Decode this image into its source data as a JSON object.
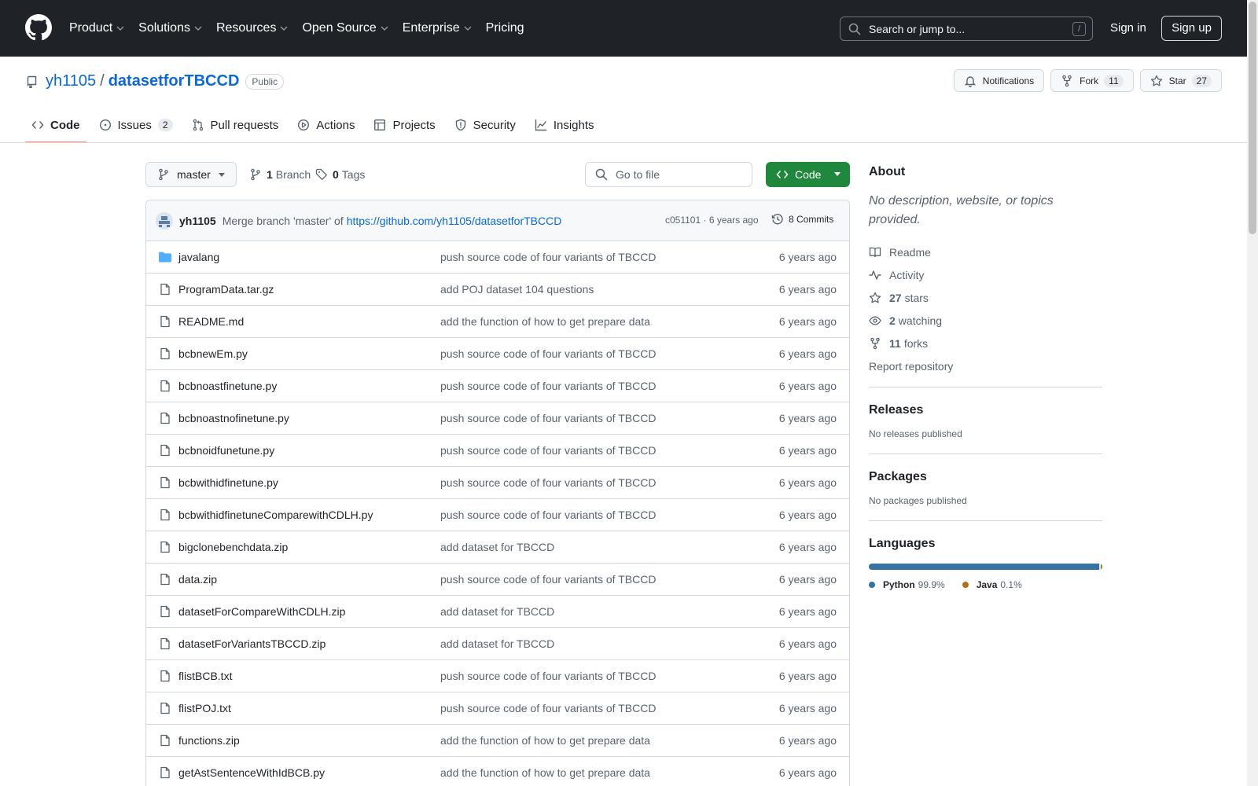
{
  "header": {
    "nav": [
      {
        "label": "Product",
        "dropdown": true
      },
      {
        "label": "Solutions",
        "dropdown": true
      },
      {
        "label": "Resources",
        "dropdown": true
      },
      {
        "label": "Open Source",
        "dropdown": true
      },
      {
        "label": "Enterprise",
        "dropdown": true
      },
      {
        "label": "Pricing",
        "dropdown": false
      }
    ],
    "search_placeholder": "Search or jump to...",
    "search_shortcut": "/",
    "signin": "Sign in",
    "signup": "Sign up"
  },
  "repo": {
    "owner": "yh1105",
    "separator": "/",
    "name": "datasetforTBCCD",
    "visibility": "Public",
    "notifications_label": "Notifications",
    "fork_label": "Fork",
    "fork_count": "11",
    "star_label": "Star",
    "star_count": "27"
  },
  "tabs": [
    {
      "label": "Code",
      "icon": "code-icon",
      "active": true,
      "count": null
    },
    {
      "label": "Issues",
      "icon": "issue-icon",
      "active": false,
      "count": "2"
    },
    {
      "label": "Pull requests",
      "icon": "pull-request-icon",
      "active": false,
      "count": null
    },
    {
      "label": "Actions",
      "icon": "play-icon",
      "active": false,
      "count": null
    },
    {
      "label": "Projects",
      "icon": "table-icon",
      "active": false,
      "count": null
    },
    {
      "label": "Security",
      "icon": "shield-icon",
      "active": false,
      "count": null
    },
    {
      "label": "Insights",
      "icon": "graph-icon",
      "active": false,
      "count": null
    }
  ],
  "browser": {
    "branch": "master",
    "branch_count": "1",
    "branch_label": "Branch",
    "tag_count": "0",
    "tag_label": "Tags",
    "goto_placeholder": "Go to file",
    "code_button": "Code"
  },
  "latest_commit": {
    "author": "yh1105",
    "message": "Merge branch 'master' of",
    "link": "https://github.com/yh1105/datasetforTBCCD",
    "sha_age": "c051101 · 6 years ago",
    "commits": "8 Commits"
  },
  "files": [
    {
      "name": "javalang",
      "type": "dir",
      "message": "push source code of four variants of TBCCD",
      "age": "6 years ago"
    },
    {
      "name": "ProgramData.tar.gz",
      "type": "file",
      "message": "add POJ dataset 104 questions",
      "age": "6 years ago"
    },
    {
      "name": "README.md",
      "type": "file",
      "message": "add the function of how to get prepare data",
      "age": "6 years ago"
    },
    {
      "name": "bcbnewEm.py",
      "type": "file",
      "message": "push source code of four variants of TBCCD",
      "age": "6 years ago"
    },
    {
      "name": "bcbnoastfinetune.py",
      "type": "file",
      "message": "push source code of four variants of TBCCD",
      "age": "6 years ago"
    },
    {
      "name": "bcbnoastnofinetune.py",
      "type": "file",
      "message": "push source code of four variants of TBCCD",
      "age": "6 years ago"
    },
    {
      "name": "bcbnoidfunetune.py",
      "type": "file",
      "message": "push source code of four variants of TBCCD",
      "age": "6 years ago"
    },
    {
      "name": "bcbwithidfinetune.py",
      "type": "file",
      "message": "push source code of four variants of TBCCD",
      "age": "6 years ago"
    },
    {
      "name": "bcbwithidfinetuneComparewithCDLH.py",
      "type": "file",
      "message": "push source code of four variants of TBCCD",
      "age": "6 years ago"
    },
    {
      "name": "bigclonebenchdata.zip",
      "type": "file",
      "message": "add dataset for TBCCD",
      "age": "6 years ago"
    },
    {
      "name": "data.zip",
      "type": "file",
      "message": "push source code of four variants of TBCCD",
      "age": "6 years ago"
    },
    {
      "name": "datasetForCompareWithCDLH.zip",
      "type": "file",
      "message": "add dataset for TBCCD",
      "age": "6 years ago"
    },
    {
      "name": "datasetForVariantsTBCCD.zip",
      "type": "file",
      "message": "add dataset for TBCCD",
      "age": "6 years ago"
    },
    {
      "name": "flistBCB.txt",
      "type": "file",
      "message": "push source code of four variants of TBCCD",
      "age": "6 years ago"
    },
    {
      "name": "flistPOJ.txt",
      "type": "file",
      "message": "push source code of four variants of TBCCD",
      "age": "6 years ago"
    },
    {
      "name": "functions.zip",
      "type": "file",
      "message": "add the function of how to get prepare data",
      "age": "6 years ago"
    },
    {
      "name": "getAstSentenceWithIdBCB.py",
      "type": "file",
      "message": "add the function of how to get prepare data",
      "age": "6 years ago"
    }
  ],
  "sidebar": {
    "about_title": "About",
    "about_desc": "No description, website, or topics provided.",
    "links": [
      {
        "icon": "book-icon",
        "bold": "",
        "label": "Readme"
      },
      {
        "icon": "pulse-icon",
        "bold": "",
        "label": "Activity"
      },
      {
        "icon": "star-icon",
        "bold": "27",
        "label": "stars"
      },
      {
        "icon": "eye-icon",
        "bold": "2",
        "label": "watching"
      },
      {
        "icon": "fork-icon",
        "bold": "11",
        "label": "forks"
      }
    ],
    "report": "Report repository",
    "releases_title": "Releases",
    "releases_empty": "No releases published",
    "packages_title": "Packages",
    "packages_empty": "No packages published",
    "languages_title": "Languages",
    "languages": [
      {
        "name": "Python",
        "percent": "99.9%",
        "value": 99.9,
        "color": "#3572A5"
      },
      {
        "name": "Java",
        "percent": "0.1%",
        "value": 0.1,
        "color": "#b07219"
      }
    ]
  }
}
